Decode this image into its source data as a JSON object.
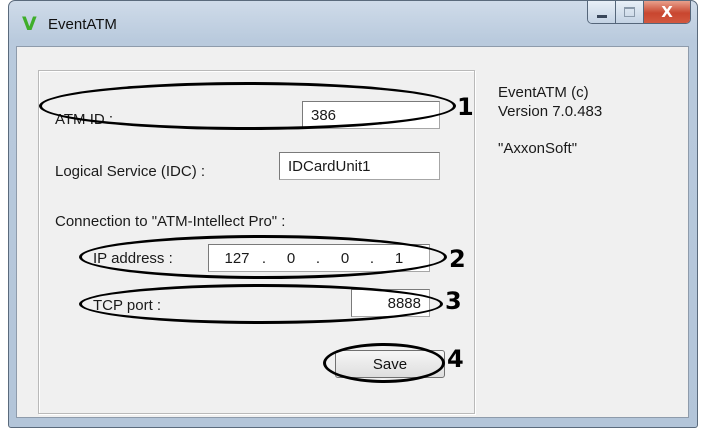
{
  "window": {
    "title": "EventATM",
    "app_icon_glyph": "V",
    "app_icon_color": "#3fae2a",
    "close_glyph": "X"
  },
  "form": {
    "atm_id": {
      "label": "ATM ID :",
      "value": "386"
    },
    "logical_service": {
      "label": "Logical Service (IDC) :",
      "value": "IDCardUnit1"
    },
    "connection_label": "Connection to \"ATM-Intellect Pro\" :",
    "ip_address": {
      "label": "IP address :",
      "octets": [
        "127",
        "0",
        "0",
        "1"
      ],
      "separator": "."
    },
    "tcp_port": {
      "label": "TCP port :",
      "value": "8888"
    },
    "save_label": "Save"
  },
  "info": {
    "line1": "EventATM (c)",
    "line2": "Version 7.0.483",
    "company": "\"AxxonSoft\""
  },
  "callouts": [
    "1",
    "2",
    "3",
    "4"
  ]
}
